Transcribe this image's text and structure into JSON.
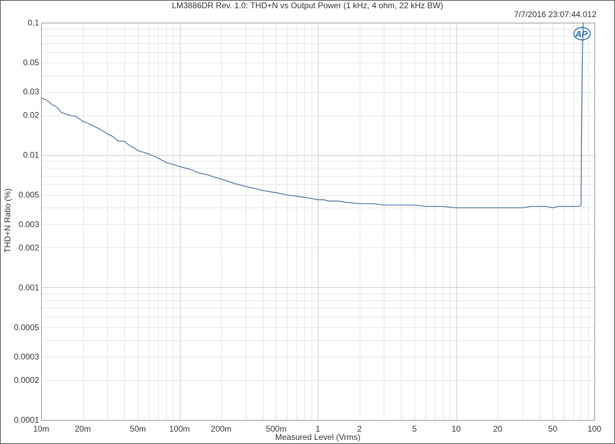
{
  "chart_data": {
    "type": "line",
    "title": "LM3886DR Rev. 1.0: THD+N vs Output Power (1 kHz, 4 ohm, 22 kHz BW)",
    "timestamp": "7/7/2016 23:07:44.012",
    "logo": "AP",
    "xlabel": "Measured Level (Vrms)",
    "ylabel": "THD+N Ratio (%)",
    "xscale": "log",
    "yscale": "log",
    "xlim": [
      0.01,
      100
    ],
    "ylim": [
      0.0001,
      0.1
    ],
    "grid": true,
    "line_color": "#4a6a9c",
    "x_ticks": [
      {
        "value": 0.01,
        "label": "10m"
      },
      {
        "value": 0.02,
        "label": "20m"
      },
      {
        "value": 0.05,
        "label": "50m"
      },
      {
        "value": 0.1,
        "label": "100m"
      },
      {
        "value": 0.2,
        "label": "200m"
      },
      {
        "value": 0.5,
        "label": "500m"
      },
      {
        "value": 1,
        "label": "1"
      },
      {
        "value": 2,
        "label": "2"
      },
      {
        "value": 5,
        "label": "5"
      },
      {
        "value": 10,
        "label": "10"
      },
      {
        "value": 20,
        "label": "20"
      },
      {
        "value": 50,
        "label": "50"
      },
      {
        "value": 100,
        "label": "100"
      }
    ],
    "y_ticks": [
      {
        "value": 0.1,
        "label": "0.1"
      },
      {
        "value": 0.05,
        "label": "0.05"
      },
      {
        "value": 0.03,
        "label": "0.03"
      },
      {
        "value": 0.02,
        "label": "0.02"
      },
      {
        "value": 0.01,
        "label": "0.01"
      },
      {
        "value": 0.005,
        "label": "0.005"
      },
      {
        "value": 0.003,
        "label": "0.003"
      },
      {
        "value": 0.002,
        "label": "0.002"
      },
      {
        "value": 0.001,
        "label": "0.001"
      },
      {
        "value": 0.0005,
        "label": "0.0005"
      },
      {
        "value": 0.0003,
        "label": "0.0003"
      },
      {
        "value": 0.0002,
        "label": "0.0002"
      },
      {
        "value": 0.0001,
        "label": "0.0001"
      }
    ],
    "series": [
      {
        "x": [
          0.01,
          0.011,
          0.012,
          0.013,
          0.014,
          0.015,
          0.016,
          0.018,
          0.02,
          0.022,
          0.025,
          0.028,
          0.03,
          0.033,
          0.036,
          0.04,
          0.044,
          0.048,
          0.05,
          0.055,
          0.06,
          0.07,
          0.08,
          0.09,
          0.1,
          0.12,
          0.14,
          0.16,
          0.18,
          0.2,
          0.25,
          0.3,
          0.35,
          0.4,
          0.5,
          0.6,
          0.7,
          0.8,
          0.9,
          1.0,
          1.1,
          1.2,
          1.4,
          1.6,
          2.0,
          2.5,
          3.0,
          3.5,
          4.0,
          5.0,
          6.0,
          7.0,
          8.0,
          10,
          12,
          15,
          20,
          25,
          30,
          35,
          40,
          45,
          50,
          55,
          60,
          70,
          78,
          80,
          81,
          82,
          83
        ],
        "y": [
          0.027,
          0.026,
          0.024,
          0.023,
          0.021,
          0.0205,
          0.02,
          0.0195,
          0.018,
          0.0173,
          0.0162,
          0.0152,
          0.0145,
          0.0138,
          0.0128,
          0.0127,
          0.0117,
          0.0112,
          0.0108,
          0.0105,
          0.0102,
          0.0095,
          0.0088,
          0.0085,
          0.0082,
          0.0078,
          0.0073,
          0.0071,
          0.0068,
          0.0066,
          0.0061,
          0.0058,
          0.0056,
          0.0054,
          0.0052,
          0.005,
          0.0049,
          0.0048,
          0.0047,
          0.0046,
          0.0046,
          0.0045,
          0.0045,
          0.0044,
          0.0043,
          0.0043,
          0.0042,
          0.0042,
          0.0042,
          0.0042,
          0.0041,
          0.0041,
          0.0041,
          0.004,
          0.004,
          0.004,
          0.004,
          0.004,
          0.004,
          0.0041,
          0.0041,
          0.0041,
          0.004,
          0.0041,
          0.0041,
          0.0041,
          0.0041,
          0.0042,
          0.02,
          0.06,
          0.1
        ]
      }
    ]
  }
}
